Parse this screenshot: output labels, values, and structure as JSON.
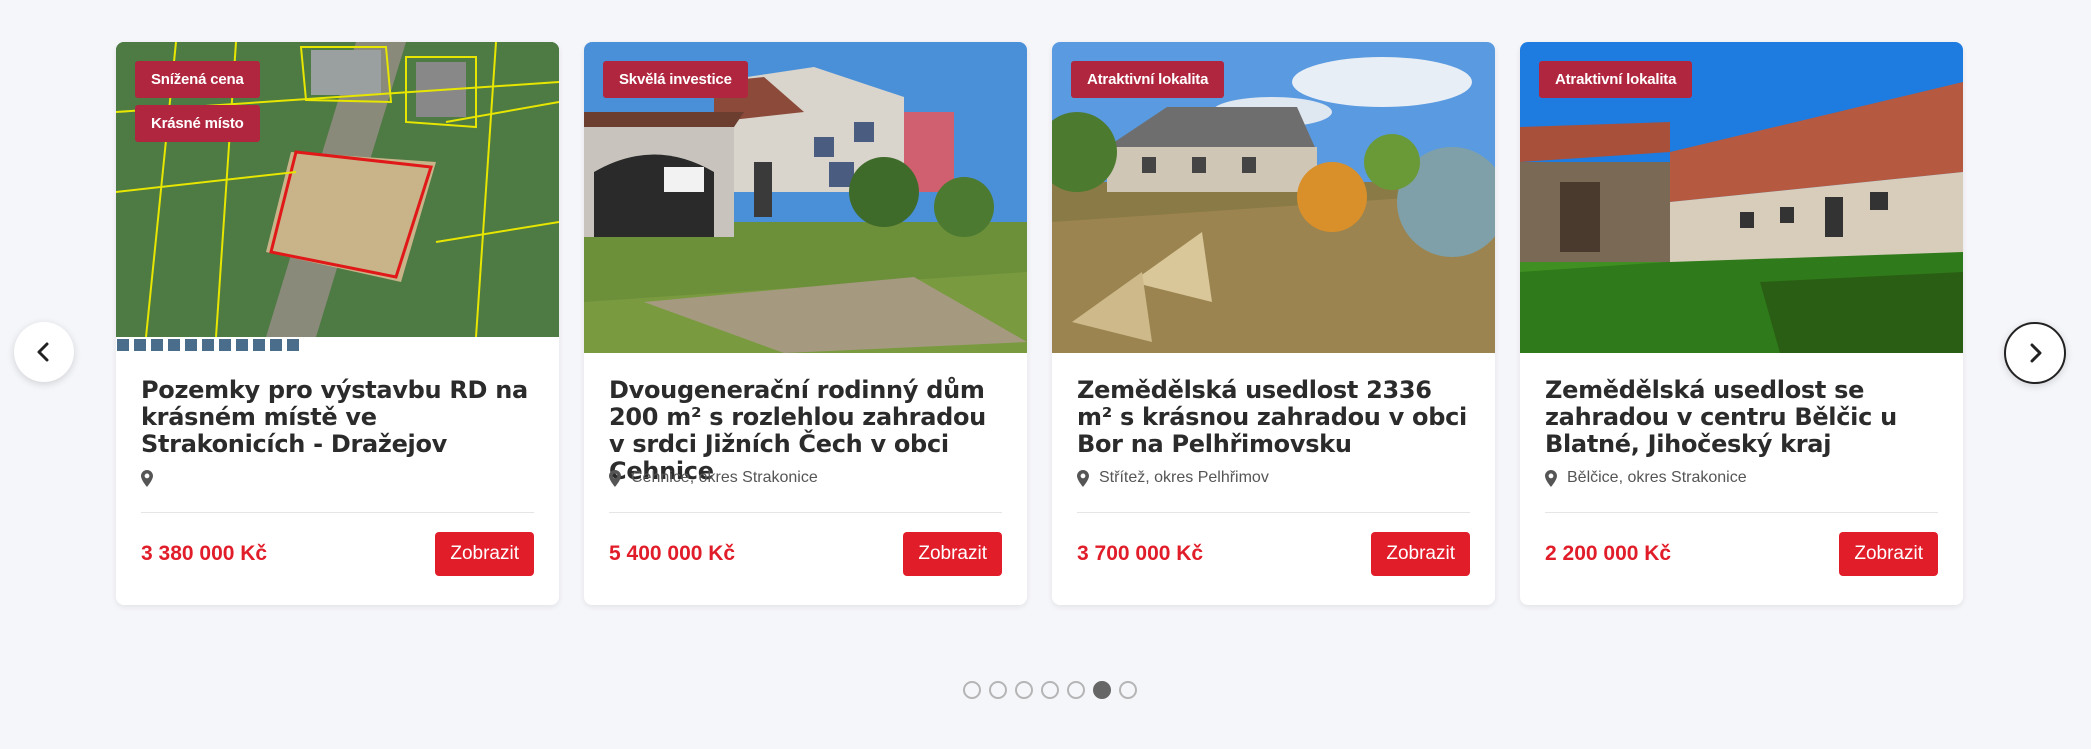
{
  "carousel": {
    "prev_icon": "chevron-left-icon",
    "next_icon": "chevron-right-icon",
    "dots_total": 7,
    "dots_active_index": 5
  },
  "cards": [
    {
      "badges": [
        "Snížená cena",
        "Krásné místo"
      ],
      "title": "Pozemky pro výstavbu RD na krásném místě ve Strakonicích - Dražejov",
      "location": "",
      "price": "3 380 000 Kč",
      "button": "Zobrazit"
    },
    {
      "badges": [
        "Skvělá investice"
      ],
      "title": "Dvougenerační rodinný dům 200 m² s rozlehlou zahradou v srdci Jižních Čech v obci Cehnice",
      "location": "Cehnice, okres Strakonice",
      "price": "5 400 000 Kč",
      "button": "Zobrazit"
    },
    {
      "badges": [
        "Atraktivní lokalita"
      ],
      "title": "Zemědělská usedlost 2336 m² s krásnou zahradou v obci Bor na Pelhřimovsku",
      "location": "Střítež, okres Pelhřimov",
      "price": "3 700 000 Kč",
      "button": "Zobrazit"
    },
    {
      "badges": [
        "Atraktivní lokalita"
      ],
      "title": "Zemědělská usedlost se zahradou v centru Bělčic u Blatné, Jihočeský kraj",
      "location": "Bělčice, okres Strakonice",
      "price": "2 200 000 Kč",
      "button": "Zobrazit"
    }
  ],
  "colors": {
    "badge": "#b1263f",
    "accent": "#e11d2a",
    "background": "#f5f6fa"
  }
}
